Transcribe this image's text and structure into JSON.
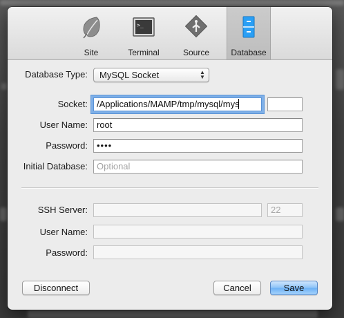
{
  "toolbar": {
    "items": [
      {
        "label": "Site",
        "icon": "leaf-icon"
      },
      {
        "label": "Terminal",
        "icon": "terminal-icon"
      },
      {
        "label": "Source",
        "icon": "source-icon"
      },
      {
        "label": "Database",
        "icon": "database-icon",
        "active": true
      }
    ]
  },
  "database": {
    "type_label": "Database Type:",
    "type_value": "MySQL Socket",
    "socket_label": "Socket:",
    "socket_value": "/Applications/MAMP/tmp/mysql/mys",
    "socket_extra_value": "",
    "username_label": "User Name:",
    "username_value": "root",
    "password_label": "Password:",
    "password_value": "••••",
    "initial_db_label": "Initial Database:",
    "initial_db_placeholder": "Optional"
  },
  "ssh": {
    "server_label": "SSH Server:",
    "server_value": "",
    "port_value": "22",
    "username_label": "User Name:",
    "username_value": "",
    "password_label": "Password:",
    "password_value": ""
  },
  "buttons": {
    "disconnect": "Disconnect",
    "cancel": "Cancel",
    "save": "Save"
  },
  "colors": {
    "accent": "#6bb0f5",
    "focus_ring": "#7fb0e8",
    "database_icon": "#2a9ff5"
  }
}
